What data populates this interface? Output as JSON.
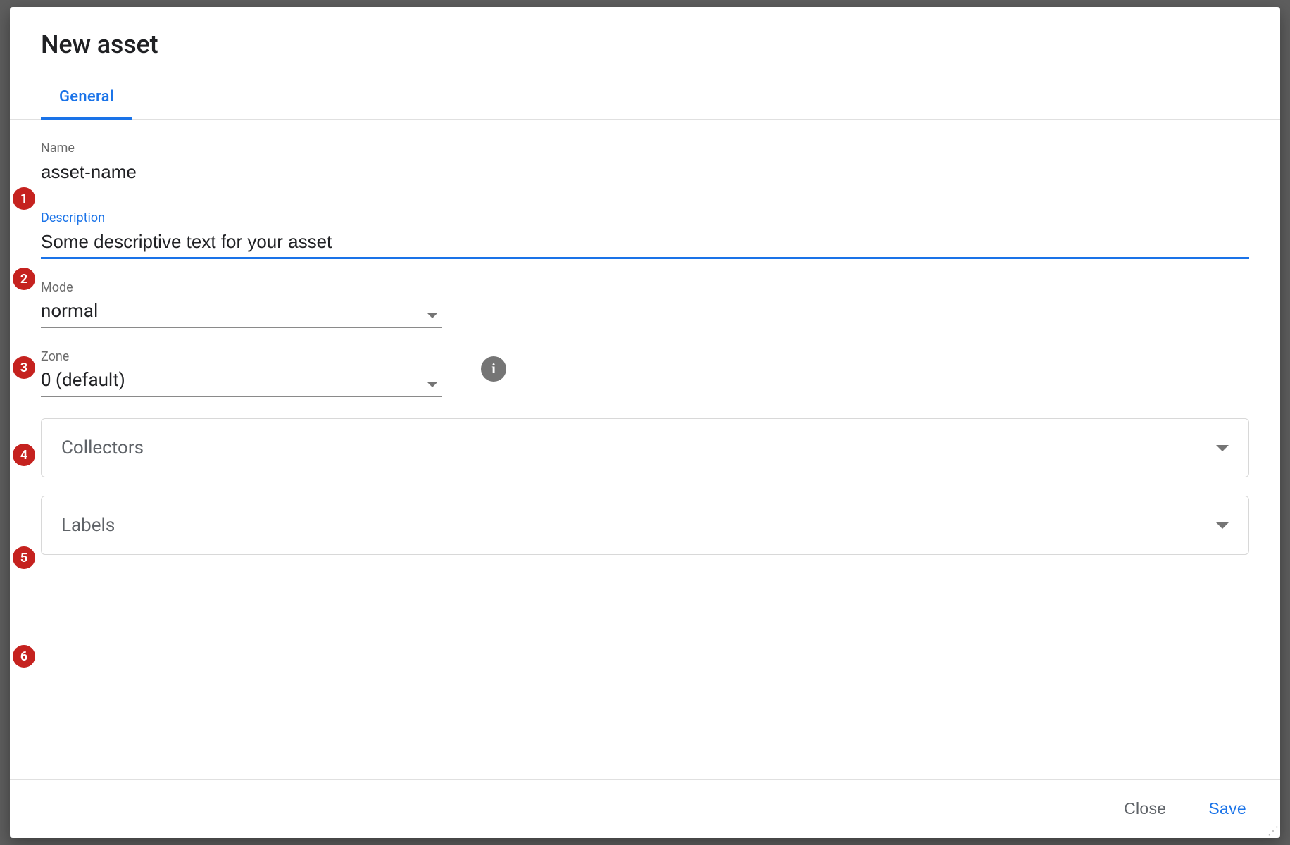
{
  "dialog": {
    "title": "New asset",
    "tabs": [
      {
        "label": "General"
      }
    ],
    "fields": {
      "name": {
        "label": "Name",
        "value": "asset-name"
      },
      "description": {
        "label": "Description",
        "value": "Some descriptive text for your asset"
      },
      "mode": {
        "label": "Mode",
        "value": "normal"
      },
      "zone": {
        "label": "Zone",
        "value": "0 (default)"
      }
    },
    "panels": {
      "collectors": {
        "title": "Collectors"
      },
      "labels": {
        "title": "Labels"
      }
    },
    "actions": {
      "close": "Close",
      "save": "Save"
    }
  },
  "icons": {
    "info": "i"
  },
  "callouts": [
    "1",
    "2",
    "3",
    "4",
    "5",
    "6"
  ],
  "colors": {
    "primary": "#1a73e8",
    "callout": "#c5221f",
    "text": "#202124",
    "muted": "#5f6368"
  }
}
